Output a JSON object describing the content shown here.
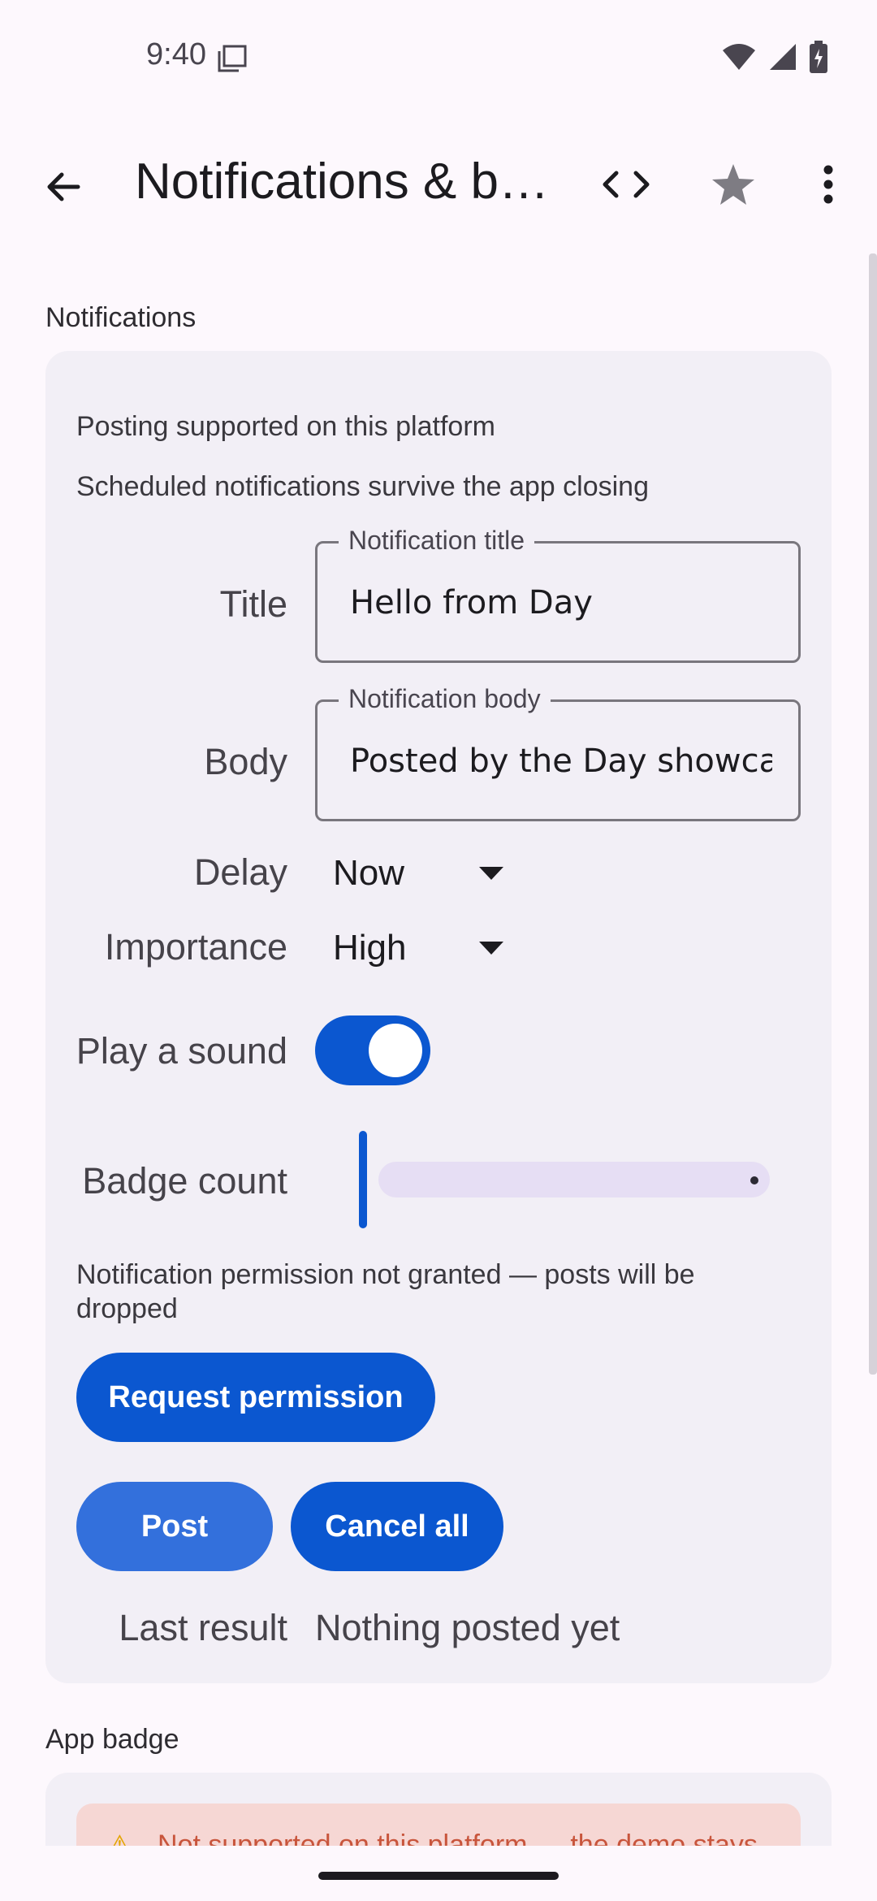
{
  "status_bar": {
    "time": "9:40"
  },
  "app_bar": {
    "title": "Notifications & badges"
  },
  "notifications": {
    "section_label": "Notifications",
    "info_posting": "Posting supported on this platform",
    "info_scheduled": "Scheduled notifications survive the app closing",
    "title_label": "Title",
    "title_field_label": "Notification title",
    "title_value": "Hello from Day",
    "body_label": "Body",
    "body_field_label": "Notification body",
    "body_value": "Posted by the Day showcase",
    "delay_label": "Delay",
    "delay_value": "Now",
    "importance_label": "Importance",
    "importance_value": "High",
    "sound_label": "Play a sound",
    "sound_on": true,
    "badge_label": "Badge count",
    "badge_value": 0,
    "permission_warning": "Notification permission not granted — posts will be dropped",
    "request_permission_label": "Request permission",
    "post_label": "Post",
    "cancel_all_label": "Cancel all",
    "last_result_label": "Last result",
    "last_result_value": "Nothing posted yet"
  },
  "app_badge": {
    "section_label": "App badge",
    "unsupported_message": "Not supported on this platform — the demo stays"
  },
  "colors": {
    "primary": "#0b57d0",
    "card_bg": "#f2eff6",
    "error_bg": "#f6d7d4"
  }
}
